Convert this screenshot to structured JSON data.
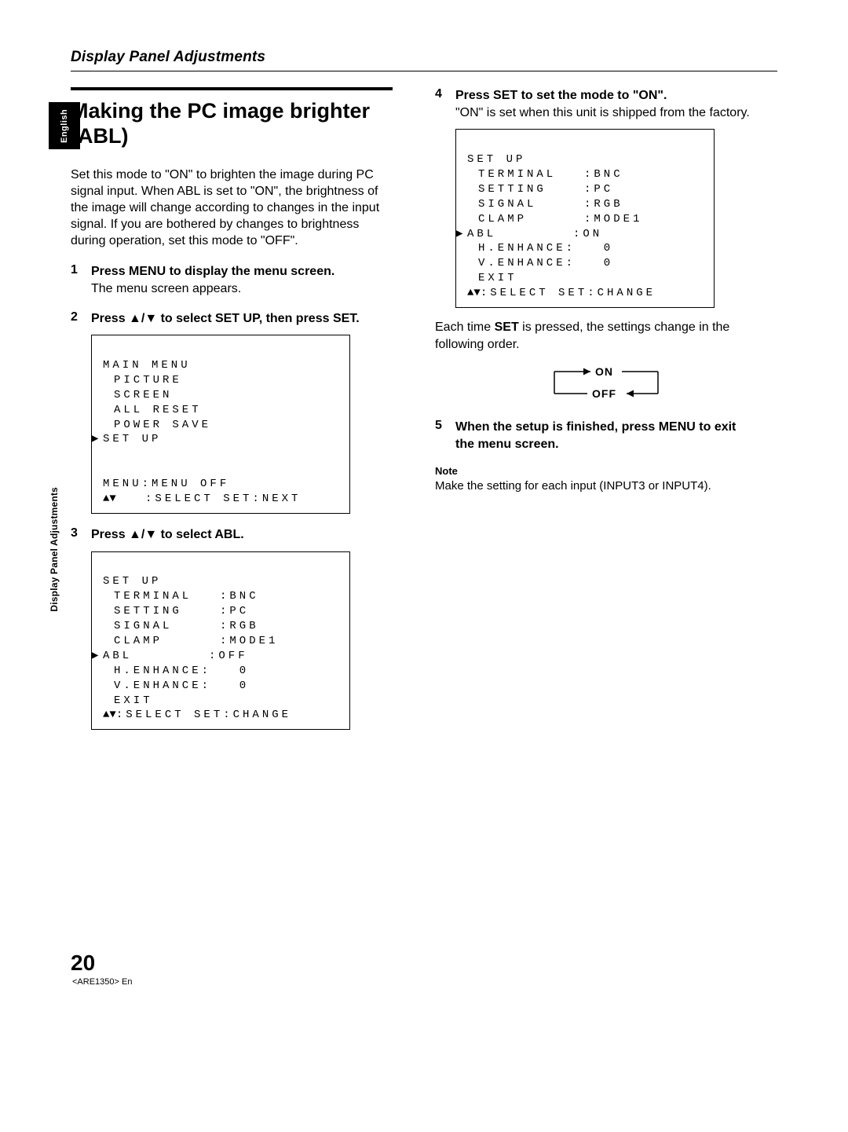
{
  "lang_tab": "English",
  "side_label": "Display Panel Adjustments",
  "section_title": "Display Panel Adjustments",
  "title": "Making the PC image brighter (ABL)",
  "intro": "Set this mode to \"ON\" to brighten the image during PC signal input. When ABL is set to \"ON\", the brightness of the image will change according to changes in the input signal. If you are bothered by changes to brightness during operation, set this mode to \"OFF\".",
  "steps_left": [
    {
      "head": "Press MENU to display the menu screen.",
      "body": "The menu screen appears."
    },
    {
      "head": "Press ▲/▼ to select SET UP, then press SET."
    },
    {
      "head": "Press ▲/▼ to select ABL."
    }
  ],
  "osd_main_menu": {
    "title": "MAIN MENU",
    "items": [
      "PICTURE",
      "SCREEN",
      "ALL RESET",
      "POWER SAVE"
    ],
    "selected": "SET UP",
    "footer1": "MENU:MENU OFF",
    "footer2_arrows": "▲▼",
    "footer2_rest": "   :SELECT SET:NEXT"
  },
  "osd_setup_off": {
    "title": "SET UP",
    "rows": [
      {
        "k": "TERMINAL",
        "v": ":BNC"
      },
      {
        "k": "SETTING",
        "v": ":PC"
      },
      {
        "k": "SIGNAL",
        "v": ":RGB"
      },
      {
        "k": "CLAMP",
        "v": ":MODE1"
      }
    ],
    "sel": {
      "k": "ABL",
      "v": ":OFF"
    },
    "rows2": [
      {
        "k": "H.ENHANCE:",
        "v": "  0"
      },
      {
        "k": "V.ENHANCE:",
        "v": "  0"
      },
      {
        "k": "EXIT",
        "v": ""
      }
    ],
    "footer_arrows": "▲▼",
    "footer_rest": ":SELECT SET:CHANGE"
  },
  "steps_right": [
    {
      "head": "Press SET to set the mode to \"ON\".",
      "body": "\"ON\" is set when this unit is shipped from the factory."
    },
    {
      "head": "When the setup is finished, press MENU to exit the menu screen."
    }
  ],
  "osd_setup_on": {
    "title": "SET UP",
    "rows": [
      {
        "k": "TERMINAL",
        "v": ":BNC"
      },
      {
        "k": "SETTING",
        "v": ":PC"
      },
      {
        "k": "SIGNAL",
        "v": ":RGB"
      },
      {
        "k": "CLAMP",
        "v": ":MODE1"
      }
    ],
    "sel": {
      "k": "ABL",
      "v": ":ON"
    },
    "rows2": [
      {
        "k": "H.ENHANCE:",
        "v": "  0"
      },
      {
        "k": "V.ENHANCE:",
        "v": "  0"
      },
      {
        "k": "EXIT",
        "v": ""
      }
    ],
    "footer_arrows": "▲▼",
    "footer_rest": ":SELECT SET:CHANGE"
  },
  "each_time_1": "Each time ",
  "each_time_set": "SET",
  "each_time_2": " is pressed, the settings change in the following order.",
  "cycle_on": "ON",
  "cycle_off": "OFF",
  "note_head": "Note",
  "note_body": "Make the setting for each input (INPUT3 or INPUT4).",
  "page_number": "20",
  "doc_id": "<ARE1350> En"
}
